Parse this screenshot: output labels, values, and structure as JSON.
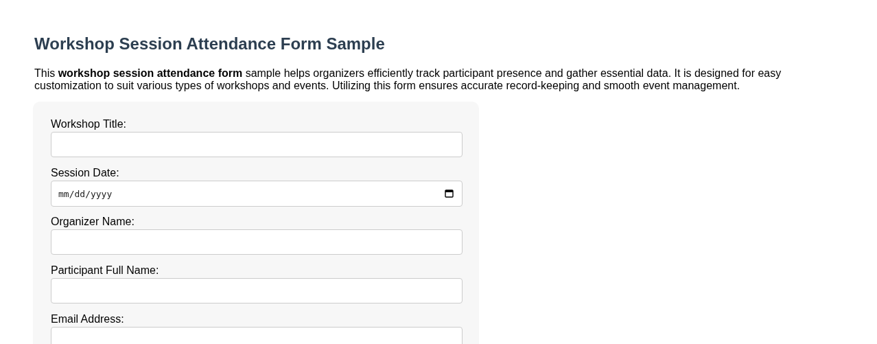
{
  "title": "Workshop Session Attendance Form Sample",
  "intro": "This **workshop session attendance form** sample helps organizers efficiently track participant presence and gather essential data. It is designed for easy customization to suit various types of workshops and events. Utilizing this form ensures accurate record-keeping and smooth event management.",
  "form": {
    "fields": [
      {
        "label": "Workshop Title:",
        "kind": "text"
      },
      {
        "label": "Session Date:",
        "kind": "date",
        "placeholder": "mm/dd/yyyy"
      },
      {
        "label": "Organizer Name:",
        "kind": "text"
      },
      {
        "label": "Participant Full Name:",
        "kind": "text"
      },
      {
        "label": "Email Address:",
        "kind": "text"
      }
    ]
  }
}
